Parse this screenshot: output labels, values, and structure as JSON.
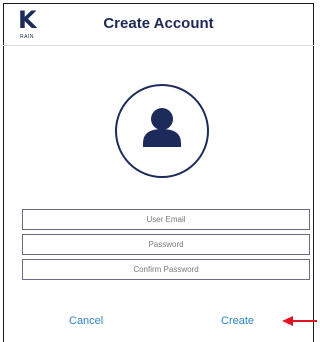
{
  "header": {
    "logo_letter": "K",
    "logo_sub": "RAIN",
    "title": "Create Account"
  },
  "avatar": {
    "icon": "user-avatar-icon",
    "color": "#1c2b5a"
  },
  "form": {
    "email_placeholder": "User Email",
    "email_value": "",
    "password_placeholder": "Password",
    "password_value": "",
    "confirm_placeholder": "Confirm Password",
    "confirm_value": ""
  },
  "actions": {
    "cancel_label": "Cancel",
    "create_label": "Create"
  },
  "annotation": {
    "icon": "red-arrow-icon",
    "color": "#e0141e"
  },
  "colors": {
    "brand": "#1c2b5a",
    "link": "#2f86c8"
  }
}
